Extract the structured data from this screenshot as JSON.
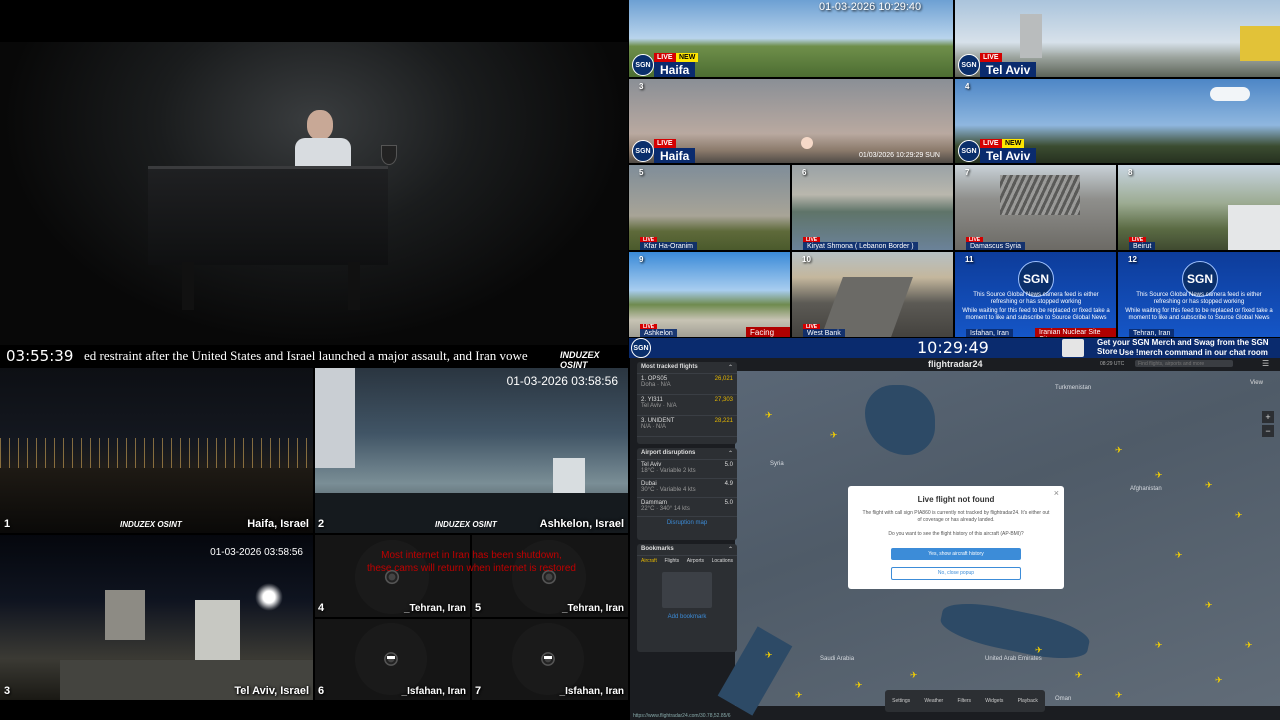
{
  "studio": {
    "clock": "03:55:39",
    "ticker": "ed restraint after the United States and Israel launched a major assault, and Iran vowe",
    "brand": "INDUZEX OSINT"
  },
  "quad_cams": [
    {
      "num": "1",
      "city": "Haifa, Israel"
    },
    {
      "num": "2",
      "city": "Ashkelon, Israel",
      "timestamp": "01-03-2026 03:58:56"
    },
    {
      "num": "3",
      "city": "Tel Aviv, Israel",
      "timestamp": "01-03-2026 03:58:56"
    },
    {
      "num": "4",
      "city": "_Tehran, Iran"
    },
    {
      "num": "5",
      "city": "_Tehran, Iran"
    },
    {
      "num": "6",
      "city": "_Isfahan, Iran"
    },
    {
      "num": "7",
      "city": "_Isfahan, Iran"
    }
  ],
  "outage_notice_line1": "Most internet in Iran has been shutdown,",
  "outage_notice_line2": "these cams will return when internet is restored",
  "sgn": {
    "logo": "SGN",
    "live": "LIVE",
    "new": "NEW",
    "top_timestamp": "01-03-2026 10:29:40",
    "cam3_timestamp": "01/03/2026 10:29:29 SUN",
    "big_cams": [
      {
        "num": "",
        "city": "Haifa"
      },
      {
        "num": "",
        "city": "Tel Aviv"
      },
      {
        "num": "3",
        "city": "Haifa"
      },
      {
        "num": "4",
        "city": "Tel Aviv"
      }
    ],
    "small_cams": [
      {
        "num": "5",
        "city": "Kfar Ha-Oranim"
      },
      {
        "num": "6",
        "city": "Kiryat Shmona ( Lebanon Border )"
      },
      {
        "num": "7",
        "city": "Damascus Syria"
      },
      {
        "num": "8",
        "city": "Beirut"
      },
      {
        "num": "9",
        "city": "Ashkelon",
        "extra": "Facing Gaza"
      },
      {
        "num": "10",
        "city": "West Bank"
      },
      {
        "num": "11",
        "city": "Isfahan, Iran",
        "extra": "Iranian Nuclear Site City"
      },
      {
        "num": "12",
        "city": "Tehran, Iran"
      }
    ],
    "offline_text_1": "This Source Global News camera feed is either refreshing or has stopped working",
    "offline_text_2": "While waiting for this feed to be replaced or fixed take a moment to like and subscribe to Source Global News",
    "clock": "10:29:49",
    "promo_line1": "Get your SGN Merch and Swag from the SGN Store",
    "promo_line2": "Use !merch command in our chat room"
  },
  "flightradar": {
    "logo": "flightradar24",
    "time": "08:29 UTC",
    "search_placeholder": "Find flights, airports and more",
    "view_label": "View",
    "most_tracked_title": "Most tracked flights",
    "most_tracked": [
      {
        "rank": "1",
        "flight": "OPS05",
        "route": "Doha · N/A",
        "count": "26,021"
      },
      {
        "rank": "2",
        "flight": "YI311",
        "route": "Tel Aviv · N/A",
        "count": "27,303"
      },
      {
        "rank": "3",
        "flight": "UNIDENT",
        "route": "N/A · N/A",
        "count": "28,221"
      }
    ],
    "disruptions_title": "Airport disruptions",
    "disruptions": [
      {
        "airport": "Tel Aviv",
        "weather": "18°C · Variable 2 kts",
        "score": "5.0"
      },
      {
        "airport": "Dubai",
        "weather": "30°C · Variable 4 kts",
        "score": "4.9"
      },
      {
        "airport": "Dammam",
        "weather": "22°C · 340° 14 kts",
        "score": "5.0"
      }
    ],
    "disruption_map_link": "Disruption map",
    "bookmarks_title": "Bookmarks",
    "bookmark_tabs": [
      "Aircraft",
      "Flights",
      "Airports",
      "Locations"
    ],
    "add_bookmark": "Add bookmark",
    "map_labels": {
      "syria": "Syria",
      "turkmenistan": "Turkmenistan",
      "afghanistan": "Afghanistan",
      "saudi": "Saudi Arabia",
      "uae": "United Arab Emirates",
      "oman": "Oman"
    },
    "dialog": {
      "title": "Live flight not found",
      "body": "The flight with call sign PIA860 is currently not tracked by flightradar24. It's either out of coverage or has already landed.",
      "question": "Do you want to see the flight history of this aircraft (AP-BMI)?",
      "primary": "Yes, show aircraft history",
      "secondary": "No, close popup",
      "close": "×"
    },
    "toolbar": [
      "Settings",
      "Weather",
      "Filters",
      "Widgets",
      "Playback"
    ],
    "url": "https://www.flightradar24.com/30.78,52.85/6"
  },
  "colors": {
    "sgn_blue": "#0a2b6e",
    "live_red": "#d40000",
    "new_yellow": "#ffe600",
    "fr_blue": "#3c8cd8",
    "flight_yellow": "#f5d000",
    "outage_red": "#cc0000"
  }
}
